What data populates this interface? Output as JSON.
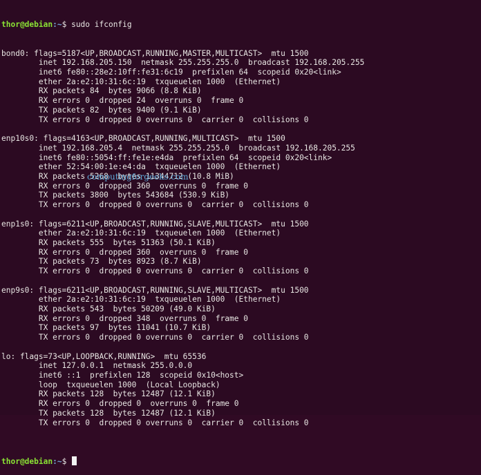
{
  "prompt": {
    "user_host": "thor@debian",
    "path": ":~",
    "symbol": "$",
    "command": "sudo ifconfig"
  },
  "output": [
    "bond0: flags=5187<UP,BROADCAST,RUNNING,MASTER,MULTICAST>  mtu 1500",
    "        inet 192.168.205.150  netmask 255.255.255.0  broadcast 192.168.205.255",
    "        inet6 fe80::28e2:10ff:fe31:6c19  prefixlen 64  scopeid 0x20<link>",
    "        ether 2a:e2:10:31:6c:19  txqueuelen 1000  (Ethernet)",
    "        RX packets 84  bytes 9066 (8.8 KiB)",
    "        RX errors 0  dropped 24  overruns 0  frame 0",
    "        TX packets 82  bytes 9400 (9.1 KiB)",
    "        TX errors 0  dropped 0 overruns 0  carrier 0  collisions 0",
    "",
    "enp10s0: flags=4163<UP,BROADCAST,RUNNING,MULTICAST>  mtu 1500",
    "        inet 192.168.205.4  netmask 255.255.255.0  broadcast 192.168.205.255",
    "        inet6 fe80::5054:ff:fe1e:e4da  prefixlen 64  scopeid 0x20<link>",
    "        ether 52:54:00:1e:e4:da  txqueuelen 1000  (Ethernet)",
    "        RX packets 5268  bytes 11344712 (10.8 MiB)",
    "        RX errors 0  dropped 360  overruns 0  frame 0",
    "        TX packets 3800  bytes 543684 (530.9 KiB)",
    "        TX errors 0  dropped 0 overruns 0  carrier 0  collisions 0",
    "",
    "enp1s0: flags=6211<UP,BROADCAST,RUNNING,SLAVE,MULTICAST>  mtu 1500",
    "        ether 2a:e2:10:31:6c:19  txqueuelen 1000  (Ethernet)",
    "        RX packets 555  bytes 51363 (50.1 KiB)",
    "        RX errors 0  dropped 360  overruns 0  frame 0",
    "        TX packets 73  bytes 8923 (8.7 KiB)",
    "        TX errors 0  dropped 0 overruns 0  carrier 0  collisions 0",
    "",
    "enp9s0: flags=6211<UP,BROADCAST,RUNNING,SLAVE,MULTICAST>  mtu 1500",
    "        ether 2a:e2:10:31:6c:19  txqueuelen 1000  (Ethernet)",
    "        RX packets 543  bytes 50209 (49.0 KiB)",
    "        RX errors 0  dropped 348  overruns 0  frame 0",
    "        TX packets 97  bytes 11041 (10.7 KiB)",
    "        TX errors 0  dropped 0 overruns 0  carrier 0  collisions 0",
    "",
    "lo: flags=73<UP,LOOPBACK,RUNNING>  mtu 65536",
    "        inet 127.0.0.1  netmask 255.0.0.0",
    "        inet6 ::1  prefixlen 128  scopeid 0x10<host>",
    "        loop  txqueuelen 1000  (Local Loopback)",
    "        RX packets 128  bytes 12487 (12.1 KiB)",
    "        RX errors 0  dropped 0  overruns 0  frame 0",
    "        TX packets 128  bytes 12487 (12.1 KiB)",
    "        TX errors 0  dropped 0 overruns 0  carrier 0  collisions 0",
    ""
  ],
  "final_prompt": {
    "user_host": "thor@debian",
    "path": ":~",
    "symbol": "$"
  },
  "watermark": "computingforgeeks.com",
  "colors": {
    "background": "#2c0a22",
    "text": "#e8e6e3",
    "user_host": "#8ae234",
    "path": "#729fcf",
    "watermark": "#5fa9d8"
  }
}
